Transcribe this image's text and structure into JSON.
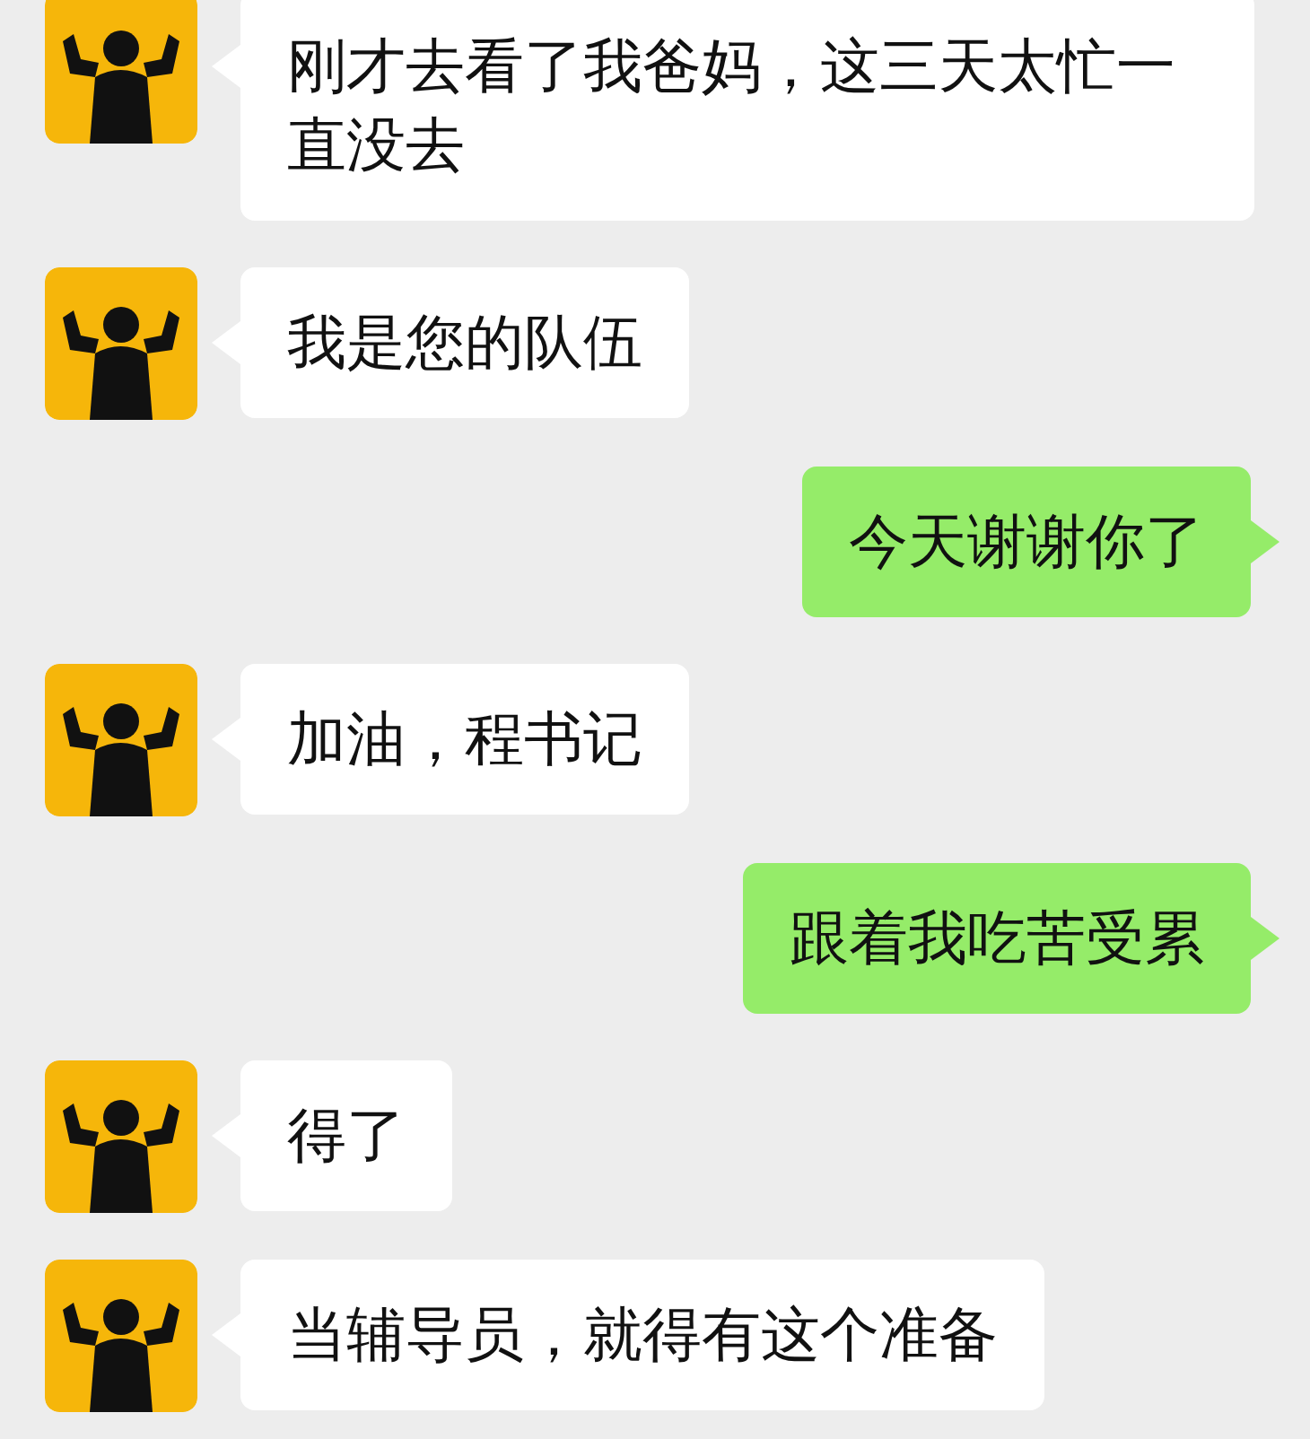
{
  "messages": [
    {
      "kind": "received",
      "text": "刚才去看了我爸妈，这三天太忙一直没去"
    },
    {
      "kind": "received",
      "text": "我是您的队伍"
    },
    {
      "kind": "sent",
      "text": "今天谢谢你了"
    },
    {
      "kind": "received",
      "text": "加油，程书记"
    },
    {
      "kind": "sent",
      "text": "跟着我吃苦受累"
    },
    {
      "kind": "received",
      "text": "得了"
    },
    {
      "kind": "received",
      "text": "当辅导员，就得有这个准备"
    }
  ]
}
